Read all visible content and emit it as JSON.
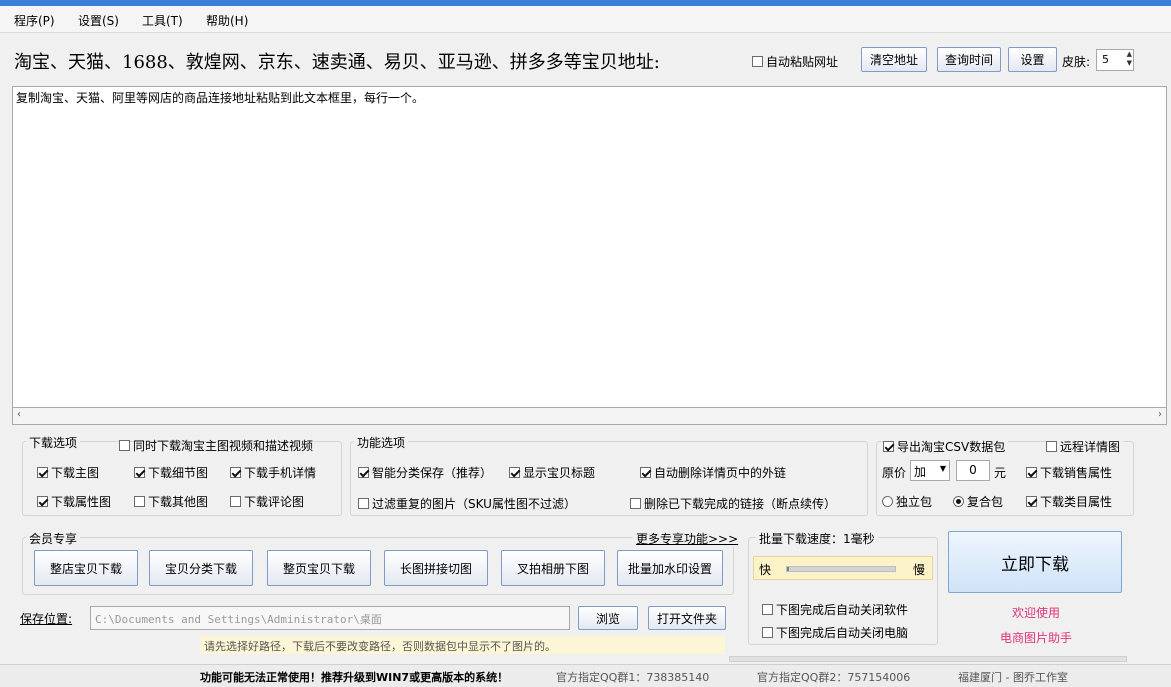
{
  "menu": {
    "items": [
      "程序(P)",
      "设置(S)",
      "工具(T)",
      "帮助(H)"
    ]
  },
  "url_bar": {
    "label": "淘宝、天猫、1688、敦煌网、京东、速卖通、易贝、亚马逊、拼多多等宝贝地址:",
    "auto_paste_label": "自动粘贴网址",
    "clear_button": "清空地址",
    "query_time_button": "查询时间",
    "settings_button": "设置",
    "skin_label": "皮肤:",
    "skin_value": "5"
  },
  "textarea": {
    "text": "复制淘宝、天猫、阿里等网店的商品连接地址粘贴到此文本框里，每行一个。"
  },
  "download_options": {
    "title": "下载选项",
    "video_option": "同时下载淘宝主图视频和描述视频",
    "main_image": "下载主图",
    "detail_image": "下载细节图",
    "mobile_detail": "下载手机详情",
    "attr_image": "下载属性图",
    "other_image": "下载其他图",
    "review_image": "下载评论图"
  },
  "function_options": {
    "title": "功能选项",
    "smart_save": "智能分类保存（推荐）",
    "show_title": "显示宝贝标题",
    "auto_remove_links": "自动删除详情页中的外链",
    "filter_dup": "过滤重复的图片（SKU属性图不过滤）",
    "delete_done_links": "删除已下载完成的链接（断点续传）"
  },
  "export_options": {
    "export_csv": "导出淘宝CSV数据包",
    "remote_detail": "远程详情图",
    "price_label": "原价",
    "price_op": "加",
    "price_value": "0",
    "price_unit": "元",
    "sales_attr": "下载销售属性",
    "standalone": "独立包",
    "composite": "复合包",
    "category_attr": "下载类目属性"
  },
  "member": {
    "title": "会员专享",
    "more": "更多专享功能>>>",
    "buttons": [
      "整店宝贝下载",
      "宝贝分类下载",
      "整页宝贝下载",
      "长图拼接切图",
      "叉拍相册下图",
      "批量加水印设置"
    ]
  },
  "speed": {
    "title": "批量下载速度：1毫秒",
    "fast": "快",
    "slow": "慢",
    "level": 0.02
  },
  "after": {
    "close_software": "下图完成后自动关闭软件",
    "shutdown": "下图完成后自动关闭电脑"
  },
  "download_now": "立即下载",
  "welcome": {
    "line1": "欢迎使用",
    "line2": "电商图片助手"
  },
  "save": {
    "label": "保存位置:",
    "path": "C:\\Documents and Settings\\Administrator\\桌面",
    "browse": "浏览",
    "open_folder": "打开文件夹",
    "hint": "请先选择好路径，下载后不要改变路径，否则数据包中显示不了图片的。"
  },
  "status": {
    "warning": "功能可能无法正常使用！推荐升级到WIN7或更高版本的系统！",
    "qq1": "官方指定QQ群1：738385140",
    "qq2": "官方指定QQ群2：757154006",
    "studio": "福建厦门 - 图乔工作室"
  },
  "colors": {
    "accent_pink": "#e0347a",
    "button_border": "#7f9cc5"
  }
}
